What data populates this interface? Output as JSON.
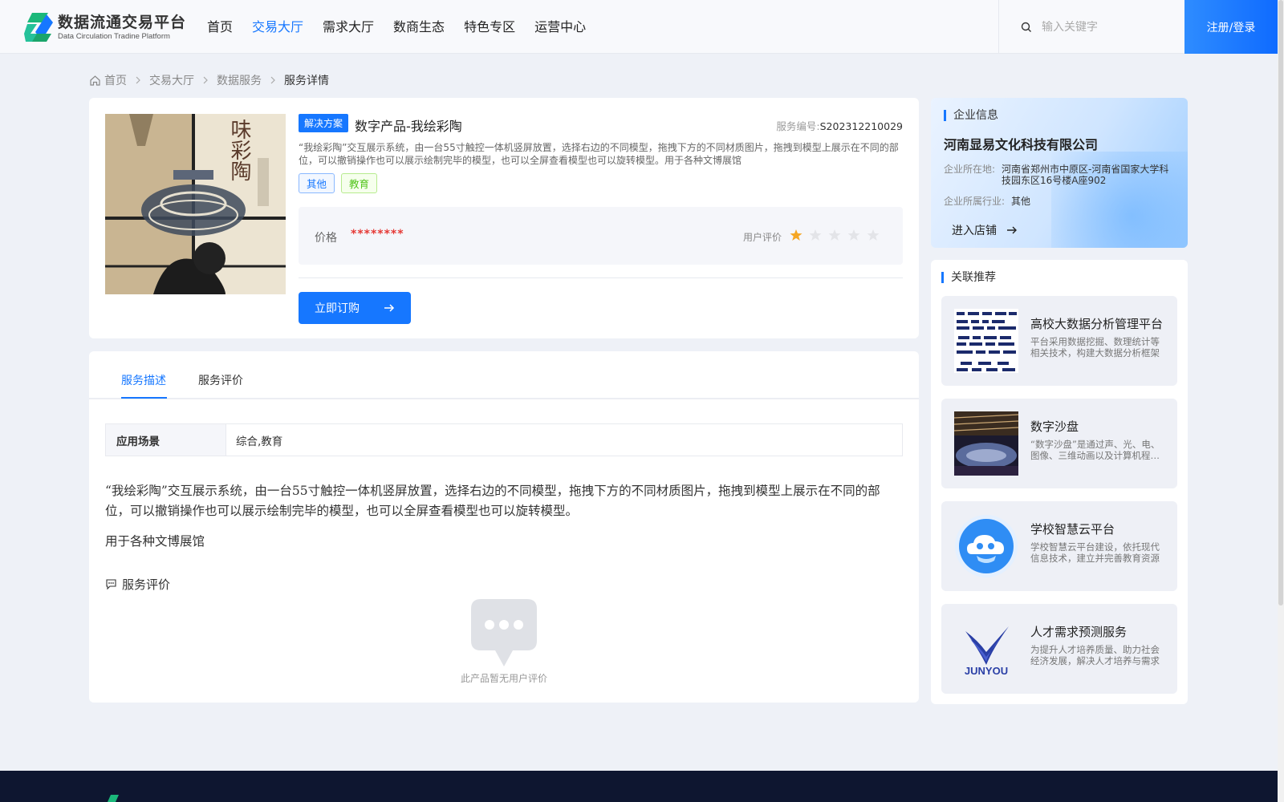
{
  "header": {
    "logo_cn": "数据流通交易平台",
    "logo_en": "Data Circulation Tradine Platform",
    "nav": [
      {
        "label": "首页",
        "active": false
      },
      {
        "label": "交易大厅",
        "active": true
      },
      {
        "label": "需求大厅",
        "active": false
      },
      {
        "label": "数商生态",
        "active": false
      },
      {
        "label": "特色专区",
        "active": false
      },
      {
        "label": "运营中心",
        "active": false
      }
    ],
    "search_placeholder": "输入关键字",
    "login_label": "注册/登录",
    "accent": "#1677ff"
  },
  "breadcrumb": [
    "首页",
    "交易大厅",
    "数据服务",
    "服务详情"
  ],
  "product": {
    "tag": "解决方案",
    "title": "数字产品-我绘彩陶",
    "code_label": "服务编号:",
    "code": "S202312210029",
    "desc": "“我绘彩陶”交互展示系统，由一台55寸触控一体机竖屏放置，选择右边的不同模型，拖拽下方的不同材质图片，拖拽到模型上展示在不同的部位，可以撤销操作也可以展示绘制完毕的模型，也可以全屏查看模型也可以旋转模型。用于各种文博展馆",
    "tags": [
      "其他",
      "教育"
    ],
    "price_label": "价格",
    "price": "********",
    "rating_label": "用户评价",
    "rating": 1,
    "rating_max": 5,
    "buy_label": "立即订购",
    "image_text": "味彩陶"
  },
  "tabs": [
    {
      "label": "服务描述",
      "active": true
    },
    {
      "label": "服务评价",
      "active": false
    }
  ],
  "description": {
    "scene_label": "应用场景",
    "scene_value": "综合,教育",
    "paragraph1": "“我绘彩陶”交互展示系统，由一台55寸触控一体机竖屏放置，选择右边的不同模型，拖拽下方的不同材质图片，拖拽到模型上展示在不同的部位，可以撤销操作也可以展示绘制完毕的模型，也可以全屏查看模型也可以旋转模型。",
    "paragraph2": "用于各种文博展馆",
    "review_title": "服务评价",
    "empty_text": "此产品暂无用户评价"
  },
  "company": {
    "section_title": "企业信息",
    "name": "河南显易文化科技有限公司",
    "location_label": "企业所在地:",
    "location": "河南省郑州市中原区-河南省国家大学科技园东区16号楼A座902",
    "industry_label": "企业所属行业:",
    "industry": "其他",
    "shop_label": "进入店铺"
  },
  "recommend": {
    "section_title": "关联推荐",
    "items": [
      {
        "title": "高校大数据分析管理平台",
        "desc": "平台采用数据挖掘、数理统计等相关技术，构建大数据分析框架"
      },
      {
        "title": "数字沙盘",
        "desc": "“数字沙盘”是通过声、光、电、图像、三维动画以及计算机程控技术"
      },
      {
        "title": "学校智慧云平台",
        "desc": "学校智慧云平台建设，依托现代信息技术，建立并完善教育资源"
      },
      {
        "title": "人才需求预测服务",
        "desc": "为提升人才培养质量、助力社会经济发展，解决人才培养与需求"
      }
    ],
    "brand_text": "JUNYOU"
  }
}
